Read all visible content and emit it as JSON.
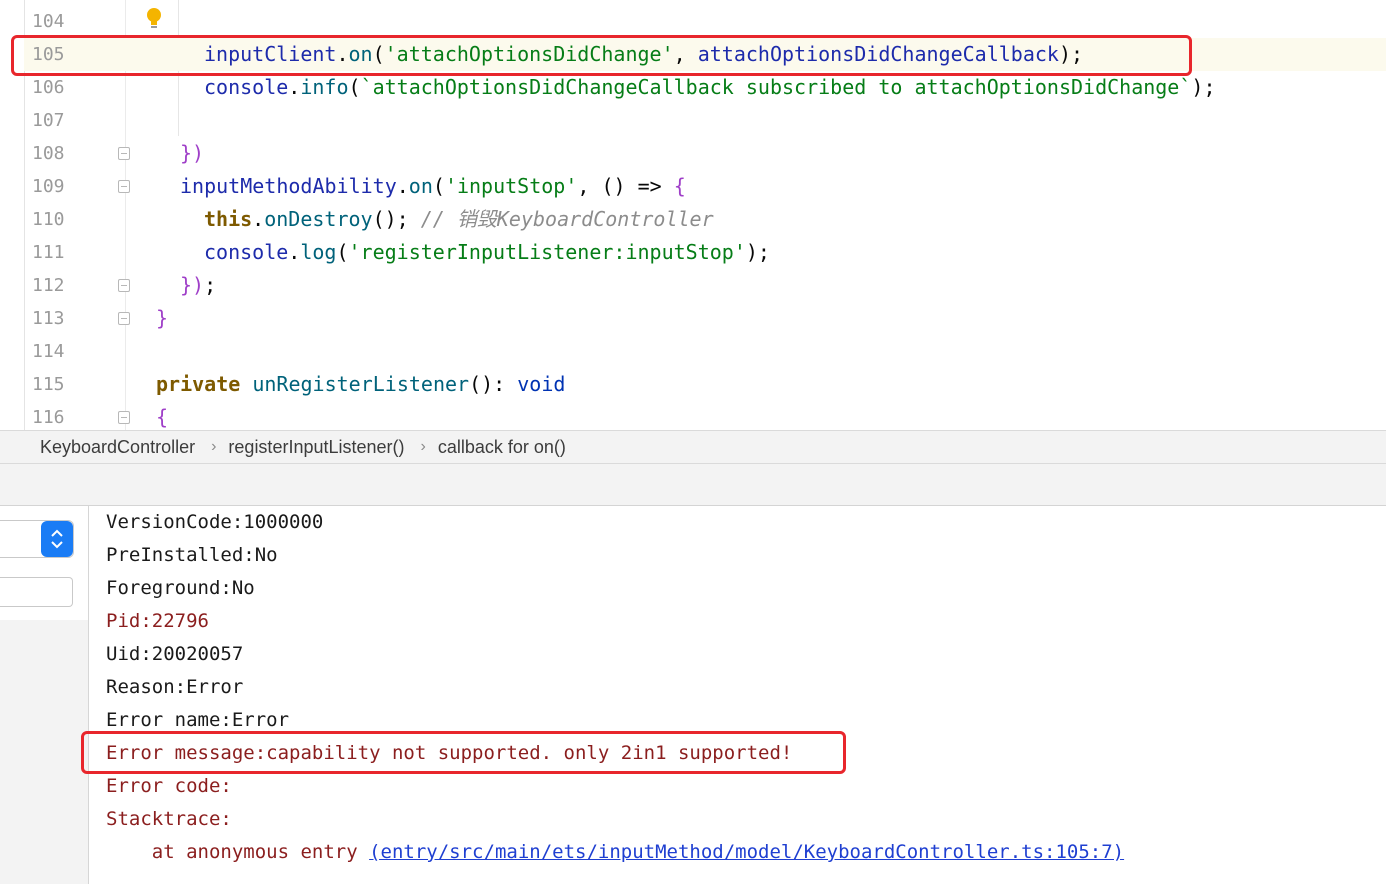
{
  "editor": {
    "lines": [
      {
        "num": "104"
      },
      {
        "num": "105",
        "tokens": [
          {
            "t": "inputClient",
            "c": "t-id"
          },
          {
            "t": ".",
            "c": "t-pun"
          },
          {
            "t": "on",
            "c": "t-fn"
          },
          {
            "t": "(",
            "c": "t-pun"
          },
          {
            "t": "'attachOptionsDidChange'",
            "c": "t-str"
          },
          {
            "t": ", ",
            "c": "t-pun"
          },
          {
            "t": "attachOptionsDidChangeCallback",
            "c": "t-id"
          },
          {
            "t": ");",
            "c": "t-pun"
          }
        ]
      },
      {
        "num": "106",
        "tokens": [
          {
            "t": "console",
            "c": "t-id"
          },
          {
            "t": ".",
            "c": "t-pun"
          },
          {
            "t": "info",
            "c": "t-fn"
          },
          {
            "t": "(",
            "c": "t-pun"
          },
          {
            "t": "`attachOptionsDidChangeCallback subscribed to attachOptionsDidChange`",
            "c": "t-str"
          },
          {
            "t": ");",
            "c": "t-pun"
          }
        ]
      },
      {
        "num": "107"
      },
      {
        "num": "108",
        "tokens": [
          {
            "t": "})",
            "c": "t-br"
          }
        ]
      },
      {
        "num": "109",
        "tokens": [
          {
            "t": "inputMethodAbility",
            "c": "t-id"
          },
          {
            "t": ".",
            "c": "t-pun"
          },
          {
            "t": "on",
            "c": "t-fn"
          },
          {
            "t": "(",
            "c": "t-pun"
          },
          {
            "t": "'inputStop'",
            "c": "t-str"
          },
          {
            "t": ", () => ",
            "c": "t-pun"
          },
          {
            "t": "{",
            "c": "t-br"
          }
        ]
      },
      {
        "num": "110",
        "tokens": [
          {
            "t": "this",
            "c": "t-kw"
          },
          {
            "t": ".",
            "c": "t-pun"
          },
          {
            "t": "onDestroy",
            "c": "t-fn"
          },
          {
            "t": "(); ",
            "c": "t-pun"
          },
          {
            "t": "// 销毁KeyboardController",
            "c": "t-cm"
          }
        ]
      },
      {
        "num": "111",
        "tokens": [
          {
            "t": "console",
            "c": "t-id"
          },
          {
            "t": ".",
            "c": "t-pun"
          },
          {
            "t": "log",
            "c": "t-fn"
          },
          {
            "t": "(",
            "c": "t-pun"
          },
          {
            "t": "'registerInputListener:inputStop'",
            "c": "t-str"
          },
          {
            "t": ");",
            "c": "t-pun"
          }
        ]
      },
      {
        "num": "112",
        "tokens": [
          {
            "t": "})",
            "c": "t-br"
          },
          {
            "t": ";",
            "c": "t-pun"
          }
        ]
      },
      {
        "num": "113",
        "tokens": [
          {
            "t": "}",
            "c": "t-br"
          }
        ]
      },
      {
        "num": "114"
      },
      {
        "num": "115",
        "tokens": [
          {
            "t": "private ",
            "c": "t-kw"
          },
          {
            "t": "unRegisterListener",
            "c": "t-fn"
          },
          {
            "t": "(): ",
            "c": "t-pun"
          },
          {
            "t": "void",
            "c": "t-kwb"
          }
        ]
      },
      {
        "num": "116",
        "tokens": [
          {
            "t": "{",
            "c": "t-br"
          }
        ]
      }
    ]
  },
  "breadcrumb": {
    "items": [
      "KeyboardController",
      "registerInputListener()",
      "callback for on()"
    ],
    "separator": "›"
  },
  "log": {
    "lines": [
      {
        "text": "VersionCode:1000000",
        "error": false
      },
      {
        "text": "PreInstalled:No",
        "error": false
      },
      {
        "text": "Foreground:No",
        "error": false
      },
      {
        "text": "Pid:22796",
        "error": true
      },
      {
        "text": "Uid:20020057",
        "error": false
      },
      {
        "text": "Reason:Error",
        "error": false
      },
      {
        "text": "Error name:Error",
        "error": false
      },
      {
        "text": "Error message:capability not supported. only 2in1 supported!",
        "error": true
      },
      {
        "text": "Error code:",
        "error": true
      },
      {
        "text": "Stacktrace:",
        "error": true
      }
    ],
    "stack": {
      "prefix": "    at anonymous entry ",
      "link": "(entry/src/main/ets/inputMethod/model/KeyboardController.ts:105:7)"
    }
  },
  "colors": {
    "highlight": "#e8262c",
    "error_text": "#8b1e1e",
    "link": "#1f3fd1",
    "selector_accent": "#1a7cf5"
  }
}
